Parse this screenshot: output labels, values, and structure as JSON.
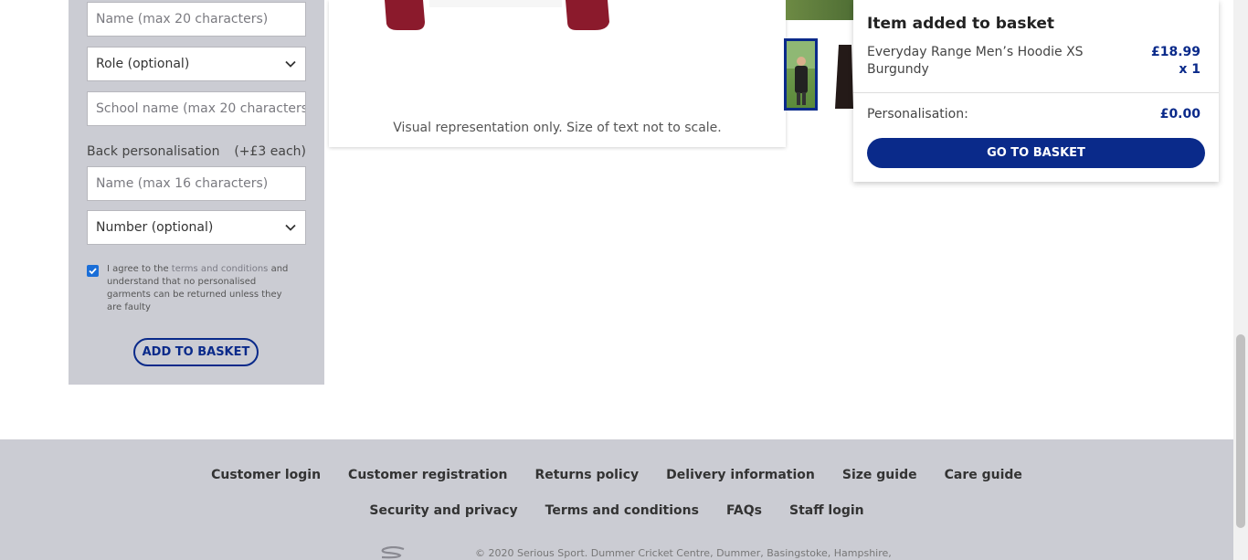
{
  "form": {
    "front_name_placeholder": "Name (max 20 characters)",
    "role_select": "Role (optional)",
    "school_placeholder": "School name (max 20 characters)",
    "back_label": "Back personalisation",
    "back_price": "(+£3 each)",
    "back_name_placeholder": "Name (max 16 characters)",
    "number_select": "Number (optional)",
    "agree_pre": "I agree to the",
    "agree_link": "terms and conditions",
    "agree_post": "and understand that no personalised garments can be returned unless they are faulty",
    "agree_checked": true,
    "add_button": "ADD TO BASKET"
  },
  "preview": {
    "caption": "Visual representation only. Size of text not to scale.",
    "hoodie_color": "#8b1a2c"
  },
  "basket_popup": {
    "title": "Item added to basket",
    "item_name": "Everyday Range Men’s Hoodie XS Burgundy",
    "item_price": "£18.99",
    "item_qty": "x 1",
    "personalisation_label": "Personalisation:",
    "personalisation_price": "£0.00",
    "go_button": "GO TO BASKET"
  },
  "footer": {
    "row1": [
      "Customer login",
      "Customer registration",
      "Returns policy",
      "Delivery information",
      "Size guide",
      "Care guide"
    ],
    "row2": [
      "Security and privacy",
      "Terms and conditions",
      "FAQs",
      "Staff login"
    ],
    "copyright": "© 2020 Serious Sport. Dummer Cricket Centre, Dummer, Basingstoke, Hampshire,"
  },
  "colors": {
    "brand": "#0a2a8a",
    "panel_bg": "#cbccd3"
  }
}
